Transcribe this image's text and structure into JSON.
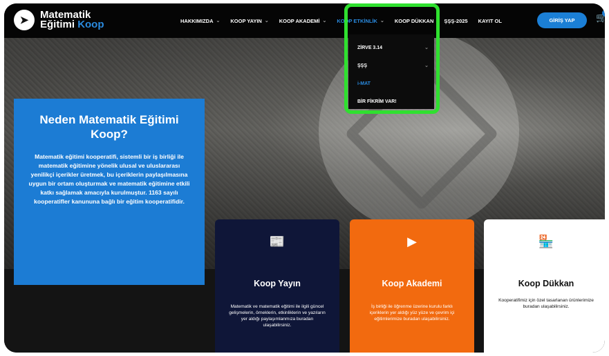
{
  "brand": {
    "line1": "Matematik",
    "line2_a": "Eğitimi",
    "line2_b": "Koop"
  },
  "nav": [
    {
      "label": "HAKKIMIZDA",
      "chevron": true
    },
    {
      "label": "KOOP YAYIN",
      "chevron": true
    },
    {
      "label": "KOOP AKADEMİ",
      "chevron": true
    },
    {
      "label": "KOOP ETKİNLİK",
      "chevron": true,
      "active": true
    },
    {
      "label": "KOOP DÜKKAN",
      "chevron": false
    },
    {
      "label": "ŞŞŞ-2025",
      "chevron": false
    },
    {
      "label": "KAYIT OL",
      "chevron": false
    }
  ],
  "login_label": "GİRİŞ YAP",
  "cart_count": "0",
  "dropdown": [
    {
      "label": "ZİRVE 3.14",
      "chevron": true
    },
    {
      "label": "ŞŞŞ",
      "chevron": true
    },
    {
      "label": "i-MAT",
      "chevron": false,
      "active": true
    },
    {
      "label": "BİR FİKRİM VAR!",
      "chevron": false
    }
  ],
  "why": {
    "title": "Neden Matematik Eğitimi Koop?",
    "body": "Matematik eğitimi kooperatifi, sistemli bir iş birliği ile matematik eğitimine yönelik ulusal ve uluslararası yenilikçi içerikler üretmek, bu içeriklerin paylaşılmasına uygun bir ortam oluşturmak ve matematik eğitimine etkili katkı sağlamak amacıyla kurulmuştur. 1163 sayılı kooperatifler kanununa bağlı bir eğitim kooperatifidir."
  },
  "cards": {
    "yayin": {
      "icon": "news-icon",
      "title": "Koop Yayın",
      "desc": "Matematik ve matematik eğitimi ile ilgili güncel gelişmelerin, örneklerin, etkinliklerin ve yazıların yer aldığı paylaşımlanmıza buradan ulaşabilirsiniz."
    },
    "akademi": {
      "icon": "video-icon",
      "title": "Koop Akademi",
      "desc": "İş birliği ile öğrenme üzerine kurulu farklı içeriklerin yer aldığı yüz yüze ve çevrim içi eğitimlerimize buradan ulaşabilirsiniz."
    },
    "dukkan": {
      "icon": "store-icon",
      "title": "Koop Dükkan",
      "desc": "Kooperatifimiz için özel tasarlanan ürünlerimize buradan ulaşabilirsiniz."
    }
  },
  "colors": {
    "accent": "#1b7fd6",
    "highlight": "#2fe02f",
    "orange": "#f26a0f",
    "navy": "#0f1638"
  }
}
